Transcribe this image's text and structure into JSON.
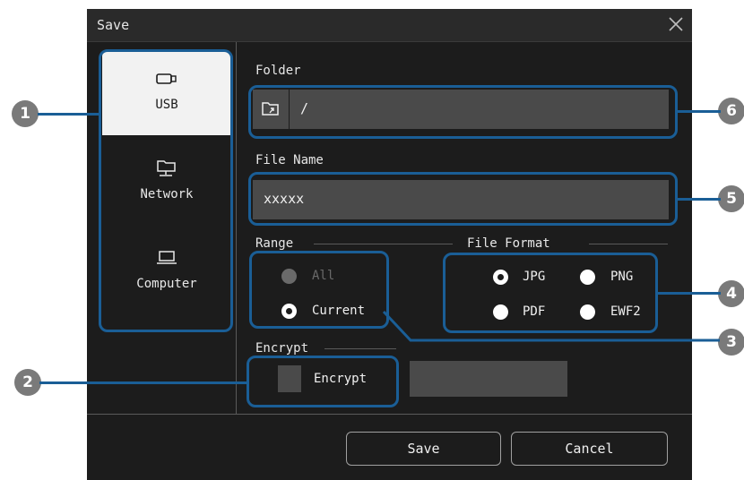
{
  "dialog": {
    "title": "Save",
    "close_icon": "close-icon"
  },
  "sources": [
    {
      "label": "USB",
      "icon": "usb-icon",
      "selected": true
    },
    {
      "label": "Network",
      "icon": "network-folder-icon",
      "selected": false
    },
    {
      "label": "Computer",
      "icon": "laptop-icon",
      "selected": false
    }
  ],
  "folder": {
    "label": "Folder",
    "value": "/",
    "icon": "folder-browse-icon"
  },
  "file_name": {
    "label": "File Name",
    "value": "xxxxx"
  },
  "range": {
    "label": "Range",
    "options": [
      {
        "label": "All",
        "selected": false,
        "disabled": true
      },
      {
        "label": "Current",
        "selected": true,
        "disabled": false
      }
    ]
  },
  "file_format": {
    "label": "File Format",
    "options": [
      {
        "label": "JPG",
        "selected": true
      },
      {
        "label": "PNG",
        "selected": false
      },
      {
        "label": "PDF",
        "selected": false
      },
      {
        "label": "EWF2",
        "selected": false
      }
    ]
  },
  "encrypt": {
    "label": "Encrypt",
    "checkbox_label": "Encrypt",
    "checked": false
  },
  "buttons": {
    "save": "Save",
    "cancel": "Cancel"
  },
  "callouts": [
    "1",
    "2",
    "3",
    "4",
    "5",
    "6"
  ],
  "colors": {
    "dialog_bg": "#1c1c1c",
    "field_bg": "#4a4a4a",
    "callout": "#1a5e96",
    "badge": "#7a7a7a"
  }
}
